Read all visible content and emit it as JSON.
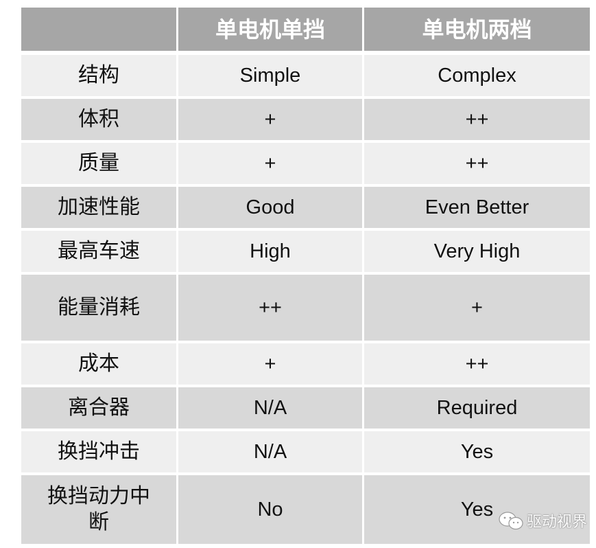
{
  "table": {
    "headers": [
      "",
      "单电机单挡",
      "单电机两档"
    ],
    "rows": [
      {
        "label": "结构",
        "single_speed": "Simple",
        "two_speed": "Complex"
      },
      {
        "label": "体积",
        "single_speed": "+",
        "two_speed": "++"
      },
      {
        "label": "质量",
        "single_speed": "+",
        "two_speed": "++"
      },
      {
        "label": "加速性能",
        "single_speed": "Good",
        "two_speed": "Even Better"
      },
      {
        "label": "最高车速",
        "single_speed": "High",
        "two_speed": "Very High"
      },
      {
        "label": "能量消耗",
        "single_speed": "++",
        "two_speed": "+"
      },
      {
        "label": "成本",
        "single_speed": "+",
        "two_speed": "++"
      },
      {
        "label": "离合器",
        "single_speed": "N/A",
        "two_speed": "Required"
      },
      {
        "label": "换挡冲击",
        "single_speed": "N/A",
        "two_speed": "Yes"
      },
      {
        "label": "换挡动力中断",
        "single_speed": "No",
        "two_speed": "Yes"
      }
    ]
  },
  "watermark": {
    "icon": "wechat-icon",
    "text": "驱动视界"
  },
  "colors": {
    "header_bg": "#a6a6a6",
    "row_light": "#efefef",
    "row_dark": "#d8d8d8"
  }
}
